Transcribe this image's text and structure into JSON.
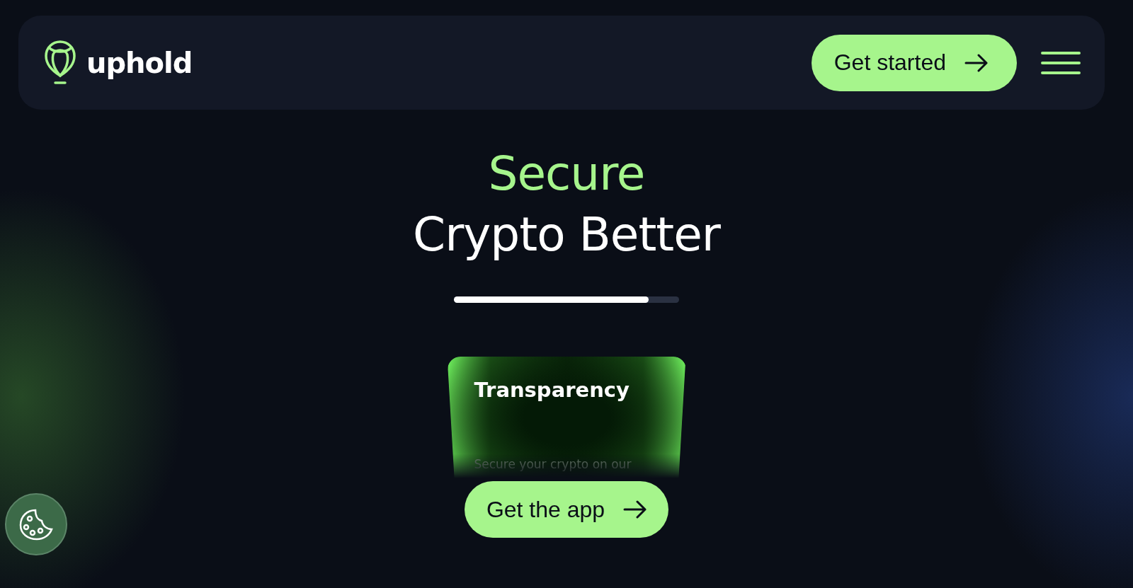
{
  "header": {
    "logo_text": "uphold",
    "cta": "Get started"
  },
  "hero": {
    "headline_accent": "Secure",
    "headline": "Crypto Better",
    "progress": {
      "level": 0.865
    }
  },
  "card": {
    "title": "Transparency",
    "text": "Secure your crypto on our"
  },
  "app_button": "Get the app"
}
